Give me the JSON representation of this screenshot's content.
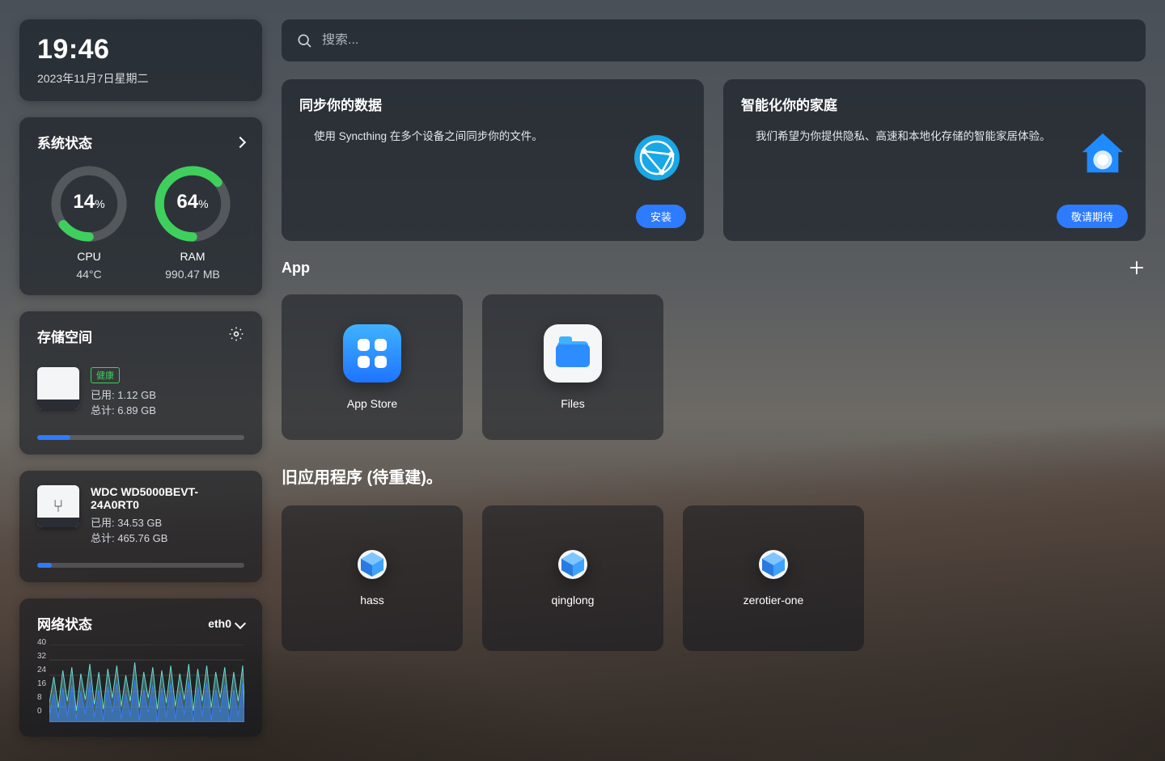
{
  "clock": {
    "time": "19:46",
    "date": "2023年11月7日星期二"
  },
  "search": {
    "placeholder": "搜索..."
  },
  "system": {
    "title": "系统状态",
    "cpu": {
      "label": "CPU",
      "percent": 14,
      "sub": "44°C"
    },
    "ram": {
      "label": "RAM",
      "percent": 64,
      "sub": "990.47 MB"
    }
  },
  "storage": {
    "title": "存储空间",
    "drives": [
      {
        "name": "",
        "health": "健康",
        "used_label": "已用: 1.12 GB",
        "total_label": "总计: 6.89 GB",
        "used_ratio": 0.16
      },
      {
        "name": "WDC WD5000BEVT-24A0RT0",
        "health": "",
        "used_label": "已用: 34.53 GB",
        "total_label": "总计: 465.76 GB",
        "used_ratio": 0.07
      }
    ]
  },
  "network": {
    "title": "网络状态",
    "iface": "eth0",
    "y_ticks": [
      "40",
      "32",
      "24",
      "16",
      "8",
      "0"
    ]
  },
  "promos": [
    {
      "title": "同步你的数据",
      "desc": "使用 Syncthing 在多个设备之间同步你的文件。",
      "button": "安装"
    },
    {
      "title": "智能化你的家庭",
      "desc": "我们希望为你提供隐私、高速和本地化存储的智能家居体验。",
      "button": "敬请期待"
    }
  ],
  "app_section": {
    "title": "App"
  },
  "apps": [
    {
      "label": "App Store"
    },
    {
      "label": "Files"
    }
  ],
  "legacy_section": {
    "title": "旧应用程序 (待重建)。"
  },
  "legacy_apps": [
    {
      "label": "hass"
    },
    {
      "label": "qinglong"
    },
    {
      "label": "zerotier-one"
    }
  ],
  "colors": {
    "accent": "#2d7bff",
    "ring": "#3fcf5d"
  }
}
